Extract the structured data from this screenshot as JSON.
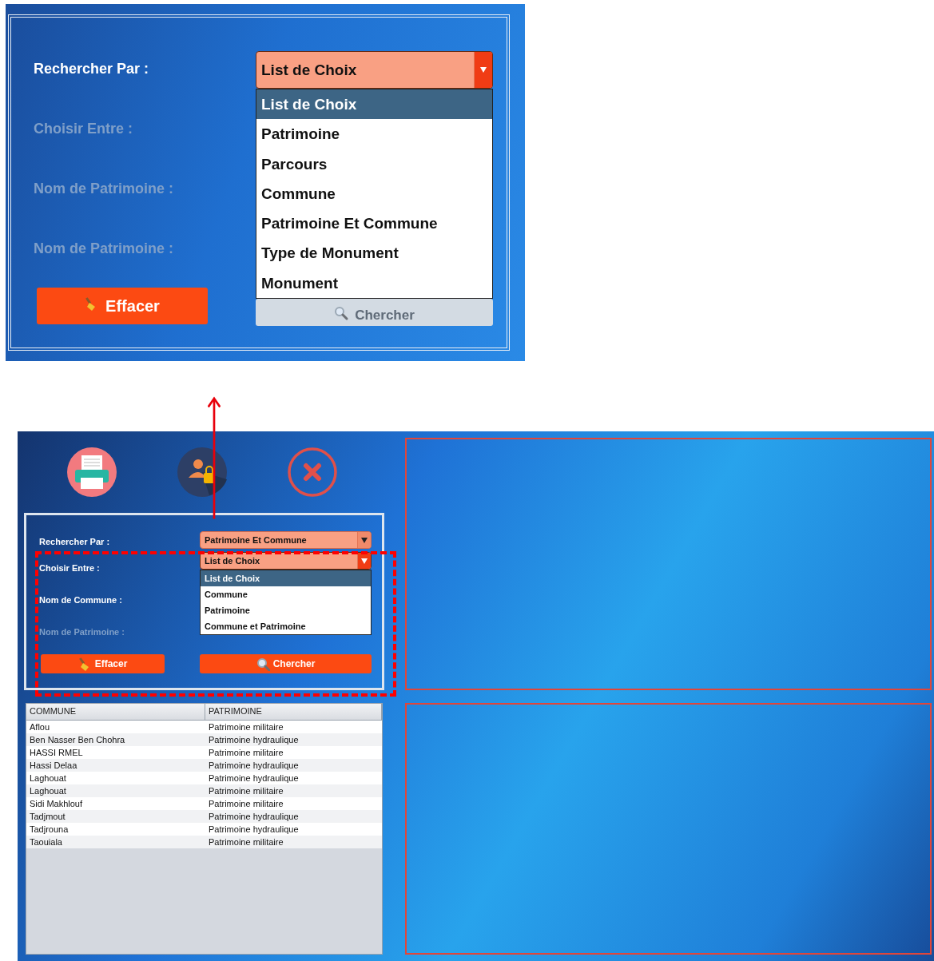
{
  "inset": {
    "fields": [
      {
        "label": "Rechercher Par :",
        "disabled": false
      },
      {
        "label": "Choisir Entre :",
        "disabled": true
      },
      {
        "label": "Nom de Patrimoine :",
        "disabled": true
      },
      {
        "label": "Nom de Patrimoine :",
        "disabled": true
      }
    ],
    "dropdown": {
      "value": "List de Choix",
      "expanded": true,
      "options": [
        {
          "label": "List de Choix",
          "selected": true
        },
        {
          "label": "Patrimoine",
          "selected": false
        },
        {
          "label": "Parcours",
          "selected": false
        },
        {
          "label": "Commune",
          "selected": false
        },
        {
          "label": "Patrimoine Et Commune",
          "selected": false
        },
        {
          "label": "Type de Monument",
          "selected": false
        },
        {
          "label": "Monument",
          "selected": false
        }
      ]
    },
    "buttons": [
      {
        "label": "Effacer",
        "kind": "clear",
        "disabled": false
      },
      {
        "label": "Chercher",
        "kind": "search",
        "disabled": true
      }
    ]
  },
  "app": {
    "toolbar": [
      {
        "kind": "print"
      },
      {
        "kind": "user-lock"
      },
      {
        "kind": "close"
      }
    ],
    "search_form": {
      "fields": [
        {
          "label": "Rechercher Par :",
          "disabled": false,
          "value": "Patrimoine Et Commune",
          "expanded": false
        },
        {
          "label": "Choisir Entre :",
          "disabled": false,
          "value": "List de Choix",
          "expanded": true,
          "options": [
            {
              "label": "List de Choix",
              "selected": true
            },
            {
              "label": "Commune",
              "selected": false
            },
            {
              "label": "Patrimoine",
              "selected": false
            },
            {
              "label": "Commune et Patrimoine",
              "selected": false
            }
          ]
        },
        {
          "label": "Nom de Commune :",
          "disabled": false
        },
        {
          "label": "Nom de Patrimoine :",
          "disabled": true
        }
      ],
      "buttons": [
        {
          "label": "Effacer",
          "kind": "clear",
          "disabled": false
        },
        {
          "label": "Chercher",
          "kind": "search",
          "disabled": false
        }
      ]
    },
    "table": {
      "columns": [
        "COMMUNE",
        "PATRIMOINE"
      ],
      "rows": [
        [
          "Aflou",
          "Patrimoine militaire"
        ],
        [
          "Ben Nasser Ben Chohra",
          "Patrimoine hydraulique"
        ],
        [
          "HASSI RMEL",
          "Patrimoine militaire"
        ],
        [
          "Hassi Delaa",
          "Patrimoine hydraulique"
        ],
        [
          "Laghouat",
          "Patrimoine hydraulique"
        ],
        [
          "Laghouat",
          "Patrimoine militaire"
        ],
        [
          "Sidi Makhlouf",
          "Patrimoine militaire"
        ],
        [
          "Tadjmout",
          "Patrimoine hydraulique"
        ],
        [
          "Tadjrouna",
          "Patrimoine hydraulique"
        ],
        [
          "Taouiala",
          "Patrimoine militaire"
        ]
      ]
    }
  }
}
